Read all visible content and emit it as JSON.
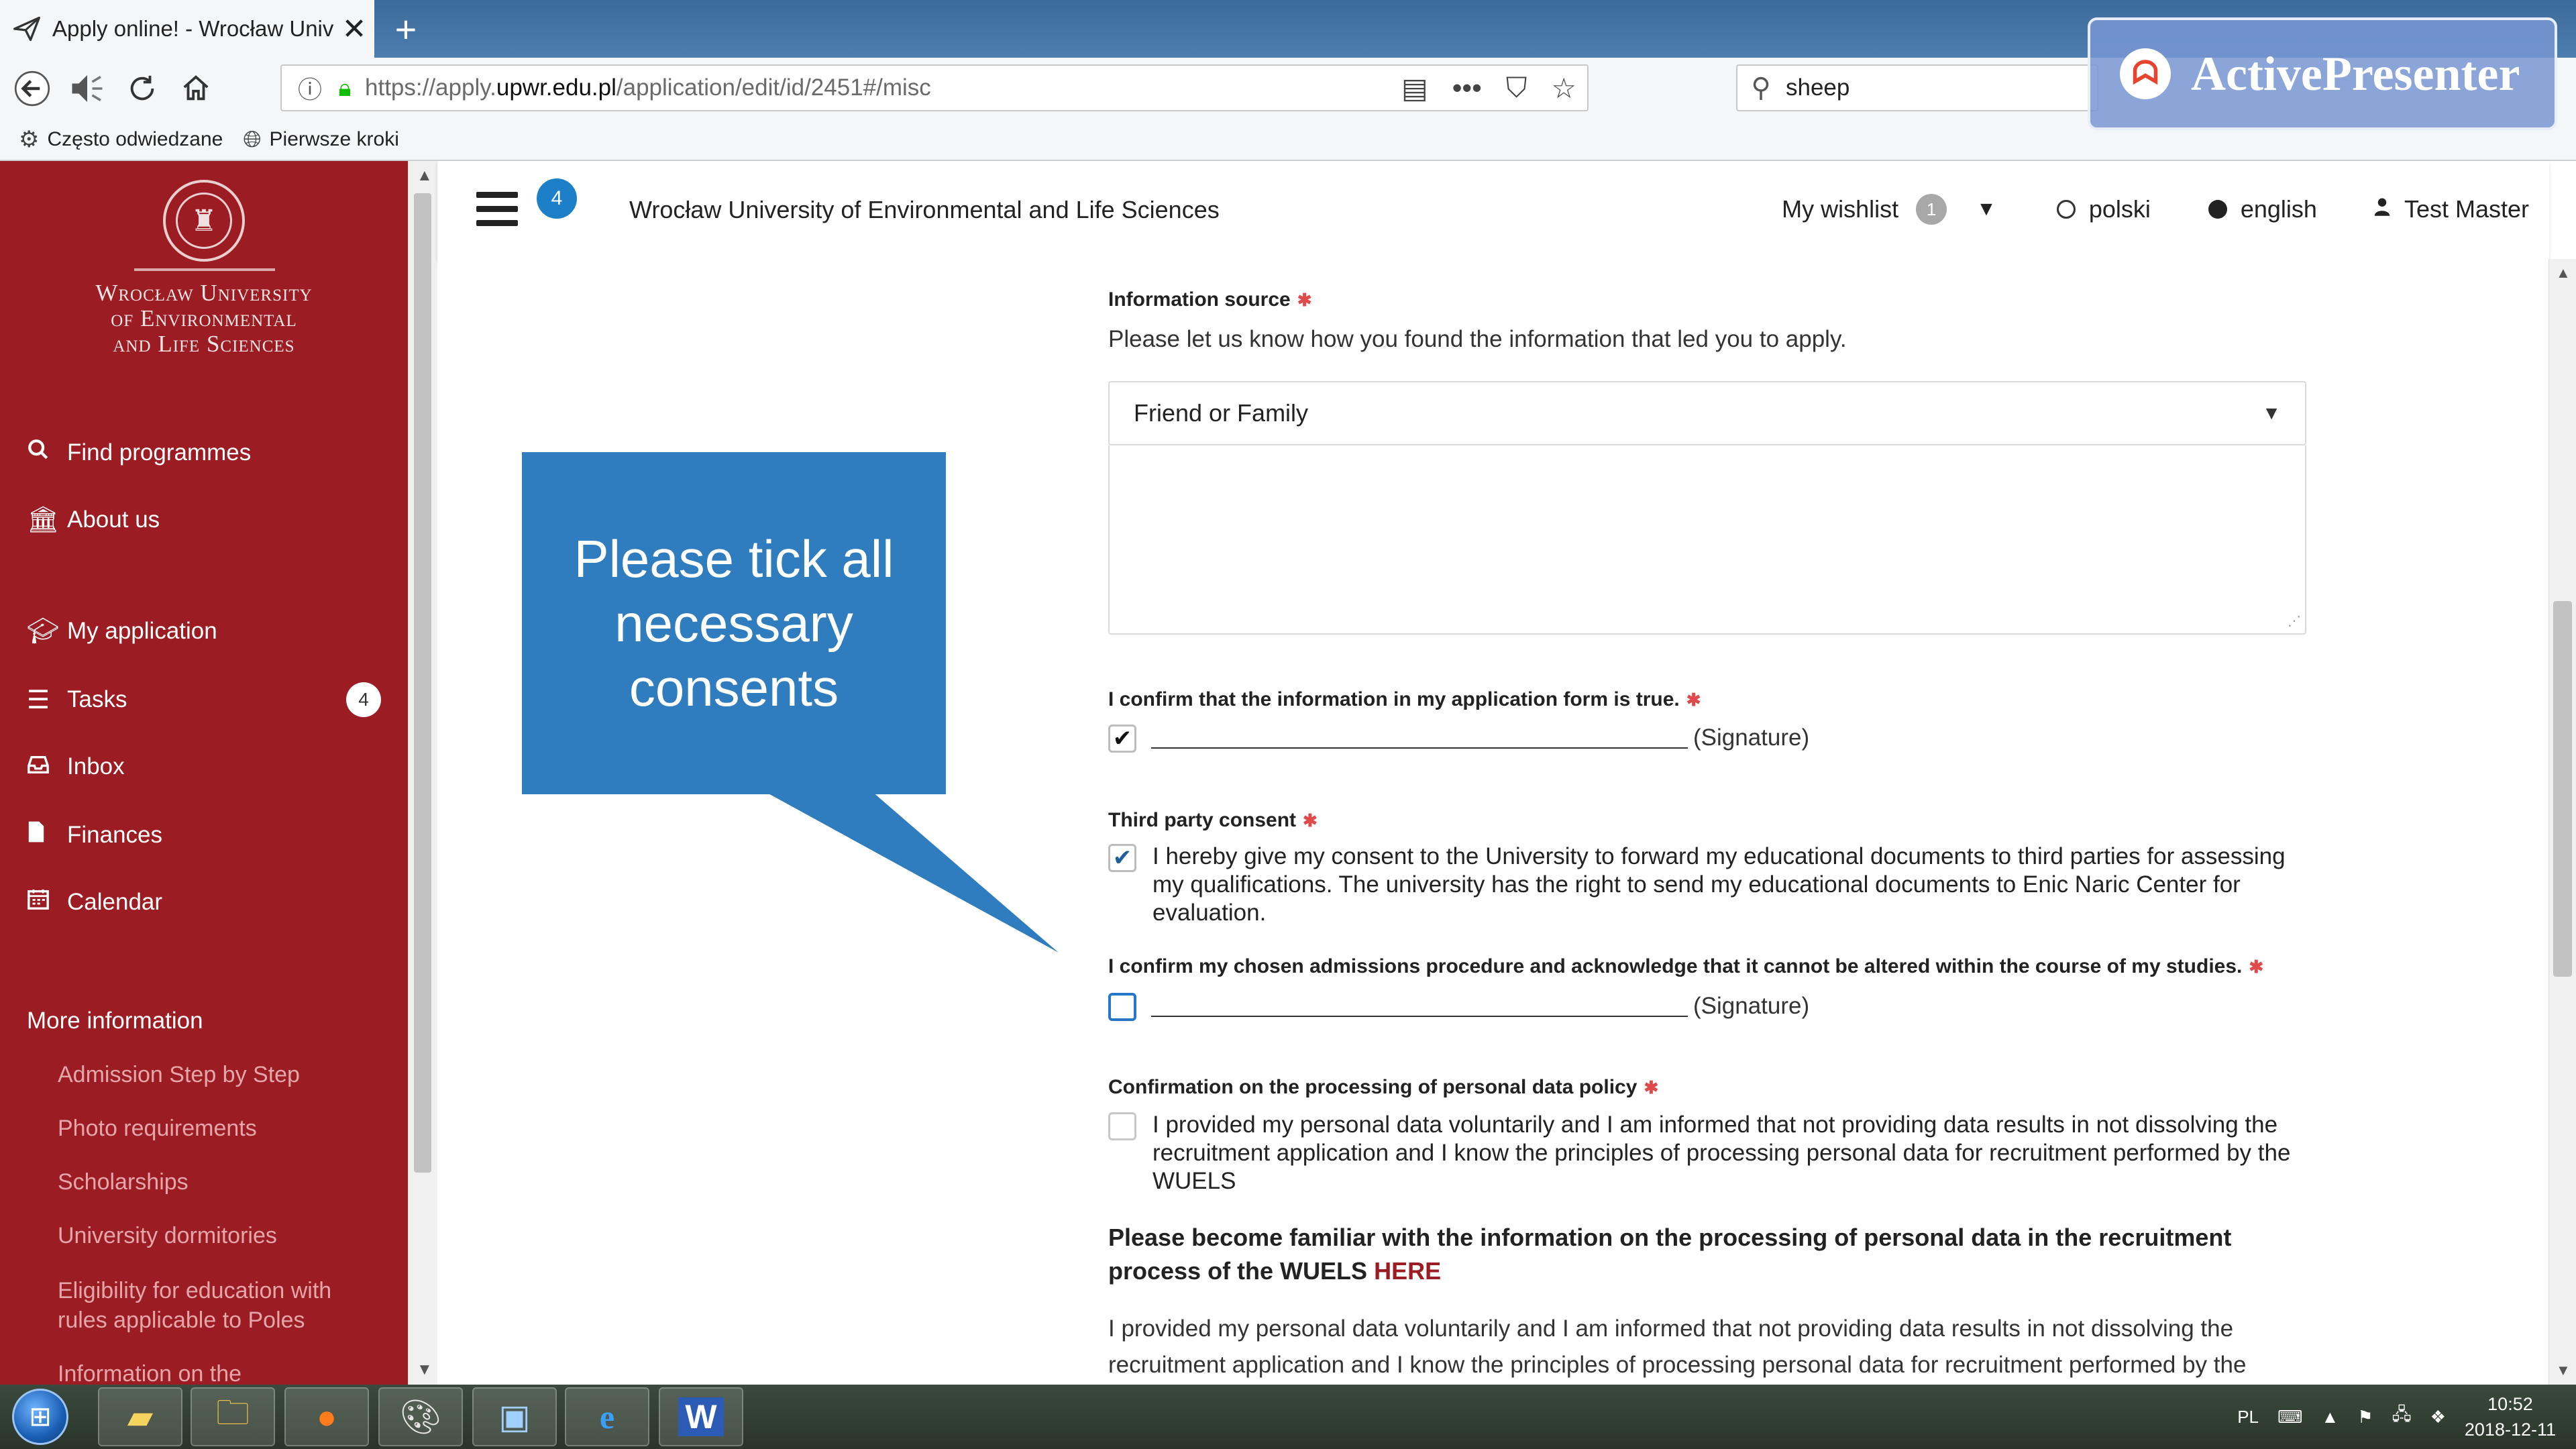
{
  "browser": {
    "tab_title": "Apply online! - Wrocław Univer",
    "new_tab": "+",
    "url_prefix": "https://apply.",
    "url_domain": "upwr.edu.pl",
    "url_path": "/application/edit/id/2451#/misc",
    "search_value": "sheep",
    "bookmarks": [
      {
        "label": "Często odwiedzane",
        "icon": "gear-icon"
      },
      {
        "label": "Pierwsze kroki",
        "icon": "globe-icon"
      }
    ]
  },
  "watermark": {
    "text": "ActivePresenter"
  },
  "sidebar": {
    "university_name": "Wrocław University of Environmental and Life Sciences",
    "nav": [
      {
        "label": "Find programmes",
        "icon": "search-icon"
      },
      {
        "label": "About us",
        "icon": "institution-icon"
      },
      {
        "label": "My application",
        "icon": "graduation-cap-icon"
      },
      {
        "label": "Tasks",
        "icon": "tasks-icon",
        "badge": "4"
      },
      {
        "label": "Inbox",
        "icon": "inbox-icon"
      },
      {
        "label": "Finances",
        "icon": "file-icon"
      },
      {
        "label": "Calendar",
        "icon": "calendar-icon"
      }
    ],
    "more_title": "More information",
    "more_links": [
      "Admission Step by Step",
      "Photo requirements",
      "Scholarships",
      "University dormitories",
      "Eligibility for education with rules applicable to Poles",
      "Information on the"
    ]
  },
  "header": {
    "menu_badge": "4",
    "title": "Wrocław University of Environmental and Life Sciences",
    "wishlist_label": "My wishlist",
    "wishlist_count": "1",
    "lang_polish": "polski",
    "lang_english": "english",
    "selected_language": "english",
    "user_name": "Test Master"
  },
  "form": {
    "info_source": {
      "label": "Information source",
      "help": "Please let us know how you found the information that led you to apply.",
      "selected": "Friend or Family",
      "textarea_value": ""
    },
    "confirm_true": {
      "label": "I confirm that the information in my application form is true.",
      "checked": true,
      "signature": "(Signature)"
    },
    "third_party": {
      "label": "Third party consent",
      "checked": true,
      "text": "I hereby give my consent to the University to forward my educational documents to third parties for assessing my qualifications. The university has the right to send my educational documents to Enic Naric Center for evaluation."
    },
    "admissions_procedure": {
      "label": "I confirm my chosen admissions procedure and acknowledge that it cannot be altered within the course of my studies.",
      "checked": false,
      "signature": "(Signature)"
    },
    "personal_data": {
      "label": "Confirmation on the processing of personal data policy",
      "checked": false,
      "text": "I provided my personal data voluntarily and I am informed that not providing data results in not dissolving the recruitment application and I know the principles of processing personal data for recruitment performed by the WUELS"
    },
    "familiar_text": "Please become familiar with the information on the processing of personal data in the recruitment process of the WUELS",
    "familiar_link": "HERE",
    "bottom_para": "I provided my personal data voluntarily and I am informed that not providing data results in not dissolving the recruitment application and I know the principles of processing personal data for recruitment performed by the"
  },
  "callout": {
    "text": "Please tick all necessary consents",
    "color": "#2f7dbf"
  },
  "taskbar": {
    "lang": "PL",
    "time": "10:52",
    "date": "2018-12-11"
  },
  "colors": {
    "sidebar": "#9b1c22",
    "accent_blue": "#1d7fc8",
    "required": "#e04a4a",
    "link_dark_red": "#9b1c22"
  }
}
